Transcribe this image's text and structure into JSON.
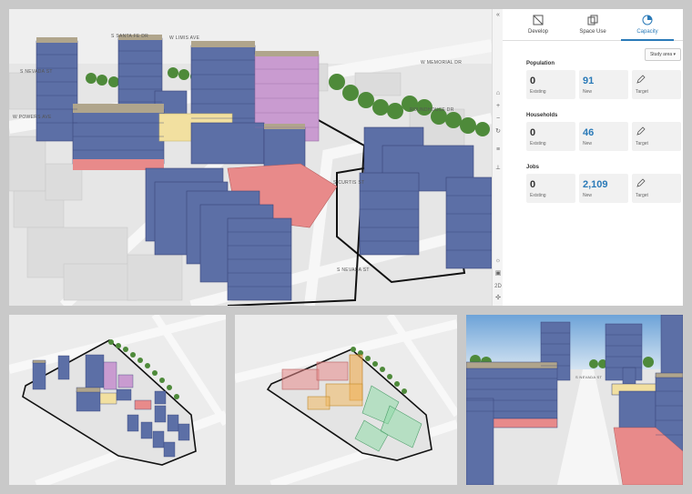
{
  "scene": {
    "street_labels": [
      "S SANTA FE DR",
      "W LIMIS AVE",
      "S NEVADA ST",
      "W POWERS AVE",
      "S CURTIS ST",
      "S NEVADA ST",
      "W MEMORIAL DR",
      "ROUNDHOUSE DR"
    ]
  },
  "toolbar": {
    "collapse": "«",
    "icons": [
      "home-icon",
      "zoom-in-icon",
      "zoom-out-icon",
      "rotate-icon",
      "layers-icon",
      "measure-icon",
      "sun-icon",
      "tilt-icon",
      "view-2d-icon",
      "compass-icon"
    ],
    "view_2d_label": "2D"
  },
  "tabs": [
    {
      "label": "Develop",
      "icon": "develop-icon",
      "active": false
    },
    {
      "label": "Space Use",
      "icon": "space-use-icon",
      "active": false
    },
    {
      "label": "Capacity",
      "icon": "capacity-icon",
      "active": true
    }
  ],
  "study_area": {
    "label": "Study area ▾"
  },
  "sections": [
    {
      "title": "Population",
      "existing": "0",
      "existing_label": "Existing",
      "new": "91",
      "new_label": "New",
      "target_label": "Target"
    },
    {
      "title": "Households",
      "existing": "0",
      "existing_label": "Existing",
      "new": "46",
      "new_label": "New",
      "target_label": "Target"
    },
    {
      "title": "Jobs",
      "existing": "0",
      "existing_label": "Existing",
      "new": "2,109",
      "new_label": "New",
      "target_label": "Target"
    }
  ],
  "colors": {
    "residential": "#5c6fa6",
    "office": "#c99bd0",
    "retail": "#e88a8a",
    "parking": "#f2e0a0",
    "roof": "#b0a58c",
    "accent": "#2a7ab8",
    "tree": "#4e8a3a"
  },
  "street_labels_view3": [
    "S NEVADA ST"
  ]
}
